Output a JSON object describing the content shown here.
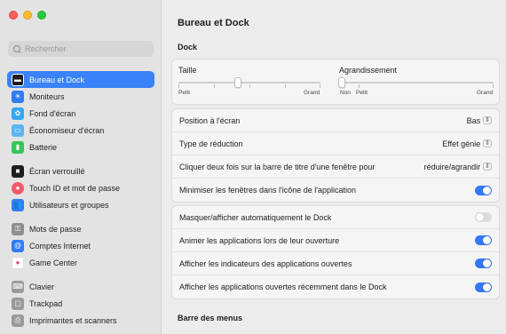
{
  "search": {
    "placeholder": "Rechercher"
  },
  "sidebar": {
    "items": [
      {
        "label": "Bureau et Dock",
        "icon": "dock-icon",
        "color": "#1d1d1f",
        "selected": true
      },
      {
        "label": "Moniteurs",
        "icon": "sun-icon",
        "color": "#2f7cf6"
      },
      {
        "label": "Fond d'écran",
        "icon": "flower-icon",
        "color": "#35a7f2"
      },
      {
        "label": "Économiseur d'écran",
        "icon": "screensaver-icon",
        "color": "#5bb5f0"
      },
      {
        "label": "Batterie",
        "icon": "battery-icon",
        "color": "#34c759"
      },
      {
        "label": "Écran verrouillé",
        "icon": "lock-icon",
        "color": "#1d1d1f"
      },
      {
        "label": "Touch ID et mot de passe",
        "icon": "fingerprint-icon",
        "color": "#f05a6b"
      },
      {
        "label": "Utilisateurs et groupes",
        "icon": "users-icon",
        "color": "#2f7cf6"
      },
      {
        "label": "Mots de passe",
        "icon": "key-icon",
        "color": "#8e8e93"
      },
      {
        "label": "Comptes Internet",
        "icon": "at-icon",
        "color": "#2f7cf6"
      },
      {
        "label": "Game Center",
        "icon": "game-center-icon",
        "color": "#ffffff"
      },
      {
        "label": "Clavier",
        "icon": "keyboard-icon",
        "color": "#9a9a9a"
      },
      {
        "label": "Trackpad",
        "icon": "trackpad-icon",
        "color": "#9a9a9a"
      },
      {
        "label": "Imprimantes et scanners",
        "icon": "printer-icon",
        "color": "#9a9a9a"
      }
    ]
  },
  "main": {
    "title": "Bureau et Dock",
    "dock_section": "Dock",
    "size_slider": {
      "label": "Taille",
      "min": "Petit",
      "max": "Grand",
      "value": 0.42
    },
    "magnify_slider": {
      "label": "Agrandissement",
      "off": "Non",
      "min": "Petit",
      "max": "Grand",
      "value": 0.0
    },
    "rows_a": [
      {
        "label": "Position à l'écran",
        "value": "Bas"
      },
      {
        "label": "Type de réduction",
        "value": "Effet génie"
      },
      {
        "label": "Cliquer deux fois sur la barre de titre d'une fenêtre pour",
        "value": "réduire/agrandir"
      },
      {
        "label": "Minimiser les fenêtres dans l'icône de l'application",
        "toggle": true
      }
    ],
    "rows_b": [
      {
        "label": "Masquer/afficher automatiquement le Dock",
        "toggle": false
      },
      {
        "label": "Animer les applications lors de leur ouverture",
        "toggle": true
      },
      {
        "label": "Afficher les indicateurs des applications ouvertes",
        "toggle": true
      },
      {
        "label": "Afficher les applications ouvertes récemment dans le Dock",
        "toggle": true
      }
    ],
    "menubar_section": "Barre des menus"
  }
}
